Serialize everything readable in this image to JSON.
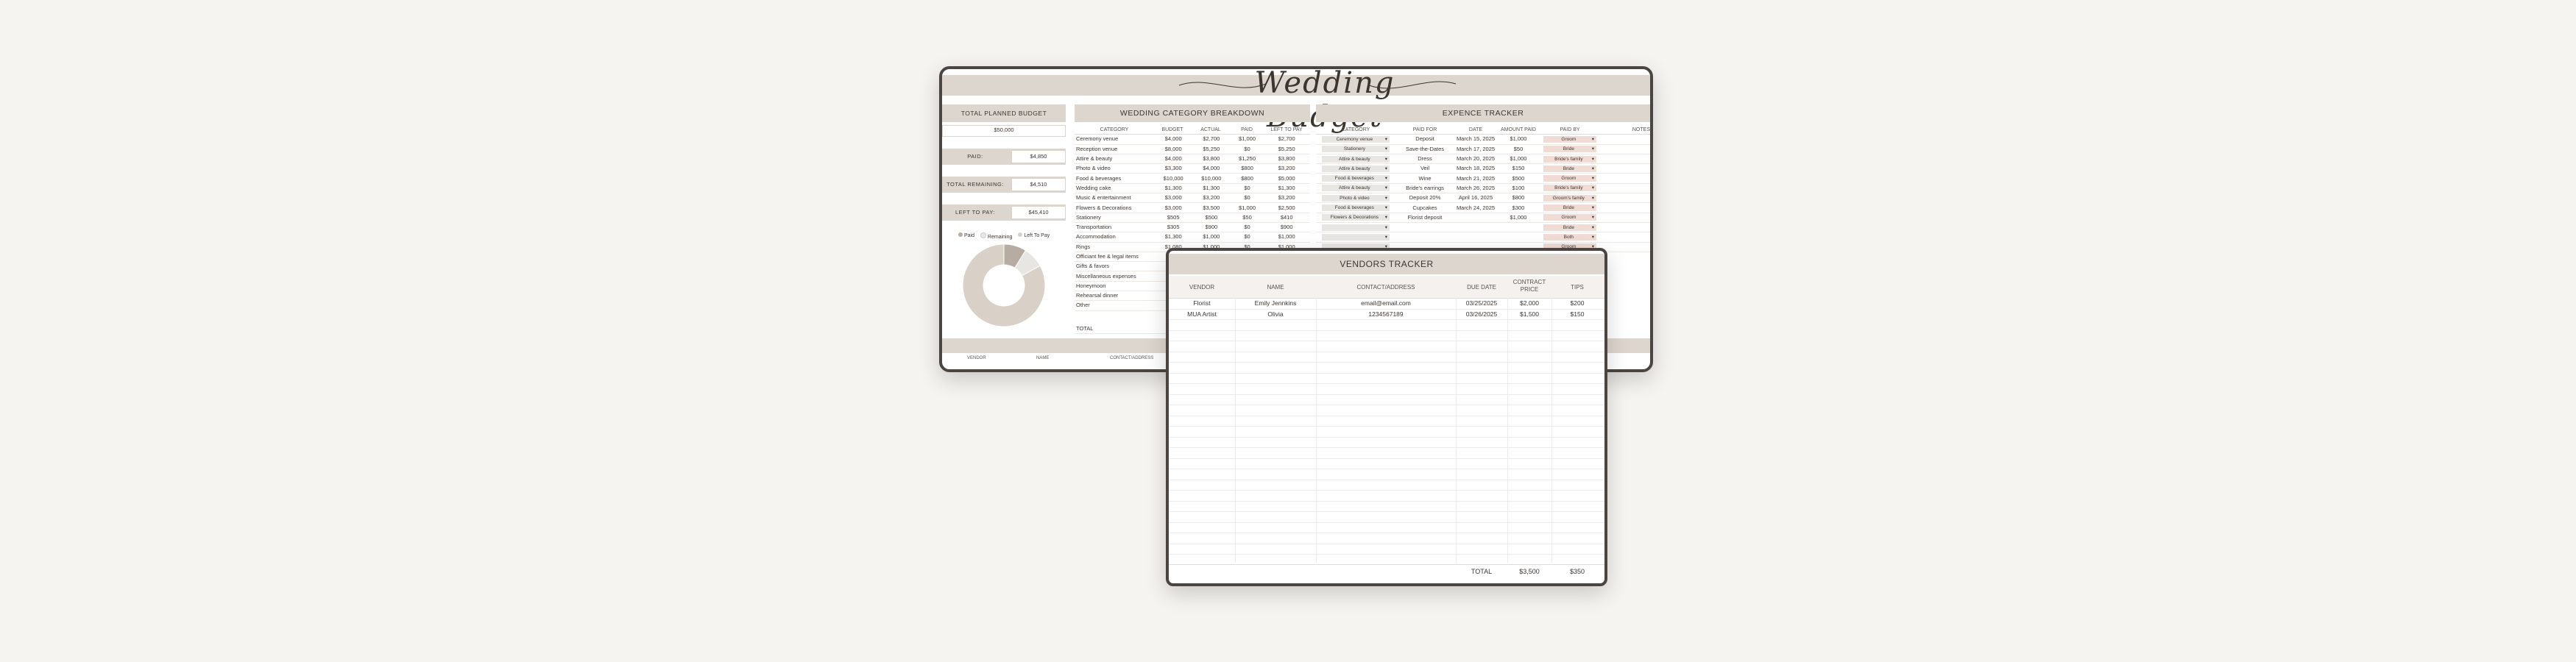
{
  "colors": {
    "background": "#f6f4f0",
    "accent": "#ddd6ce",
    "frame": "#4a4541",
    "paid_pill": "#f0dcd5",
    "category_pill": "#e8e6e3"
  },
  "title": "Wedding Budget",
  "summary": {
    "planned_label": "TOTAL PLANNED BUDGET",
    "planned_value": "$50,000",
    "paid_label": "PAID:",
    "paid_value": "$4,850",
    "remaining_label": "TOTAL REMAINING:",
    "remaining_value": "$4,510",
    "left_label": "LEFT TO PAY:",
    "left_value": "$45,410"
  },
  "legend": {
    "paid": "Paid",
    "remaining": "Remaining",
    "left": "Left To Pay"
  },
  "breakdown": {
    "title": "WEDDING CATEGORY BREAKDOWN",
    "headers": [
      "CATEGORY",
      "BUDGET",
      "ACTUAL",
      "PAID",
      "LEFT TO PAY"
    ],
    "rows": [
      [
        "Ceremony venue",
        "$4,000",
        "$2,700",
        "$1,000",
        "$2,700"
      ],
      [
        "Reception venue",
        "$8,000",
        "$5,250",
        "$0",
        "$5,250"
      ],
      [
        "Attire & beauty",
        "$4,000",
        "$3,800",
        "$1,250",
        "$3,800"
      ],
      [
        "Photo & video",
        "$3,300",
        "$4,000",
        "$800",
        "$3,200"
      ],
      [
        "Food & beverages",
        "$10,000",
        "$10,000",
        "$800",
        "$5,000"
      ],
      [
        "Wedding cake",
        "$1,300",
        "$1,300",
        "$0",
        "$1,300"
      ],
      [
        "Music & entertainment",
        "$3,000",
        "$3,200",
        "$0",
        "$3,200"
      ],
      [
        "Flowers & Decorations",
        "$3,000",
        "$3,500",
        "$1,000",
        "$2,500"
      ],
      [
        "Stationery",
        "$505",
        "$500",
        "$50",
        "$410"
      ],
      [
        "Transportation",
        "$305",
        "$900",
        "$0",
        "$900"
      ],
      [
        "Accommodation",
        "$1,300",
        "$1,000",
        "$0",
        "$1,000"
      ],
      [
        "Rings",
        "$1,080",
        "$1,000",
        "$0",
        "$1,000"
      ],
      [
        "Officiant fee & legal items",
        "",
        "",
        "",
        ""
      ],
      [
        "Gifts & favors",
        "",
        "",
        "",
        ""
      ],
      [
        "Miscellaneous expenses",
        "",
        "",
        "",
        ""
      ],
      [
        "Honeymoon",
        "",
        "",
        "",
        ""
      ],
      [
        "Rehearsal dinner",
        "",
        "",
        "",
        ""
      ],
      [
        "Other",
        "",
        "",
        "",
        ""
      ]
    ],
    "total_label": "TOTAL"
  },
  "expense": {
    "title": "EXPENCE TRACKER",
    "headers": [
      "CATEGORY",
      "PAID FOR",
      "DATE",
      "AMOUNT PAID",
      "PAID BY",
      "NOTES"
    ],
    "rows": [
      [
        "Ceremony venue",
        "Deposit",
        "March 15, 2025",
        "$1,000",
        "Groom"
      ],
      [
        "Stationery",
        "Save-the-Dates",
        "March 17, 2025",
        "$50",
        "Bride"
      ],
      [
        "Attire & beauty",
        "Dress",
        "March 20, 2025",
        "$1,000",
        "Bride's family"
      ],
      [
        "Attire & beauty",
        "Veil",
        "March 18, 2025",
        "$150",
        "Bride"
      ],
      [
        "Food & beverages",
        "Wine",
        "March 21, 2025",
        "$500",
        "Groom"
      ],
      [
        "Attire & beauty",
        "Bride's earrings",
        "March 26, 2025",
        "$100",
        "Bride's family"
      ],
      [
        "Photo & video",
        "Deposit 20%",
        "April 16, 2025",
        "$800",
        "Groom's family"
      ],
      [
        "Food & beverages",
        "Cupcakes",
        "March 24, 2025",
        "$300",
        "Bride"
      ],
      [
        "Flowers & Decorations",
        "Florist deposit",
        "",
        "$1,000",
        "Groom"
      ],
      [
        "",
        "",
        "",
        "",
        "Bride"
      ],
      [
        "",
        "",
        "",
        "",
        "Both"
      ],
      [
        "",
        "",
        "",
        "",
        "Groom"
      ]
    ]
  },
  "vendors_back": {
    "title": "VENDORS TRACKER",
    "headers": [
      "VENDOR",
      "NAME",
      "CONTACT/ADDRESS"
    ]
  },
  "vendors": {
    "title": "VENDORS TRACKER",
    "headers": [
      "VENDOR",
      "NAME",
      "CONTACT/ADDRESS",
      "DUE DATE",
      "CONTRACT PRICE",
      "TIPS"
    ],
    "rows": [
      [
        "Florist",
        "Emily Jennkins",
        "email@email.com",
        "03/25/2025",
        "$2,000",
        "$200"
      ],
      [
        "MUA Artist",
        "Olivia",
        "1234567189",
        "03/26/2025",
        "$1,500",
        "$150"
      ]
    ],
    "total_label": "TOTAL",
    "total_price": "$3,500",
    "total_tips": "$350"
  },
  "chart_data": {
    "type": "pie",
    "categories": [
      "Paid",
      "Remaining",
      "Left To Pay"
    ],
    "values": [
      4850,
      4510,
      45410
    ]
  }
}
